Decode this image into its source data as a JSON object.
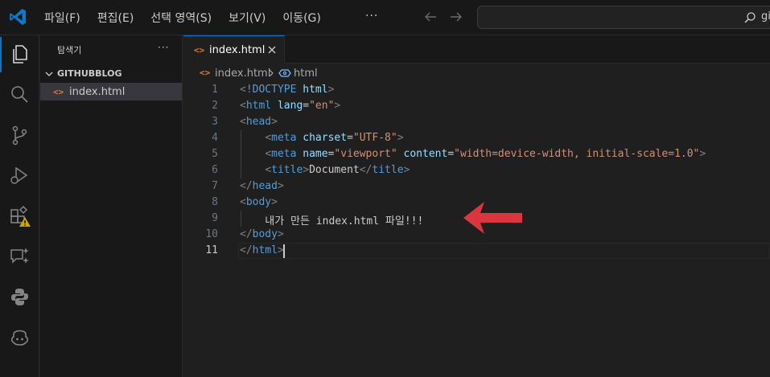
{
  "menu": [
    "파일(F)",
    "편집(E)",
    "선택 영역(S)",
    "보기(V)",
    "이동(G)"
  ],
  "more_label": "···",
  "search": {
    "text": "gi"
  },
  "sidebar": {
    "title": "탐색기",
    "more": "···",
    "folder": "GITHUBBLOG",
    "file_icon": "<>",
    "file": "index.html"
  },
  "tab": {
    "icon": "<>",
    "label": "index.html"
  },
  "breadcrumb": {
    "icon": "<>",
    "file": "index.html",
    "symbol": "html"
  },
  "editor": {
    "line_numbers": [
      "1",
      "2",
      "3",
      "4",
      "5",
      "6",
      "7",
      "8",
      "9",
      "10",
      "11"
    ],
    "lines": [
      [
        [
          "t-br",
          "<"
        ],
        [
          "t-kw",
          "!DOCTYPE "
        ],
        [
          "t-attr",
          "html"
        ],
        [
          "t-br",
          ">"
        ]
      ],
      [
        [
          "t-br",
          "<"
        ],
        [
          "t-tag",
          "html "
        ],
        [
          "t-attr",
          "lang"
        ],
        [
          "t-txt",
          "="
        ],
        [
          "t-str",
          "\"en\""
        ],
        [
          "t-br",
          ">"
        ]
      ],
      [
        [
          "t-br",
          "<"
        ],
        [
          "t-tag",
          "head"
        ],
        [
          "t-br",
          ">"
        ]
      ],
      [
        [
          "t-txt",
          "    "
        ],
        [
          "t-br",
          "<"
        ],
        [
          "t-tag",
          "meta "
        ],
        [
          "t-attr",
          "charset"
        ],
        [
          "t-txt",
          "="
        ],
        [
          "t-str",
          "\"UTF-8\""
        ],
        [
          "t-br",
          ">"
        ]
      ],
      [
        [
          "t-txt",
          "    "
        ],
        [
          "t-br",
          "<"
        ],
        [
          "t-tag",
          "meta "
        ],
        [
          "t-attr",
          "name"
        ],
        [
          "t-txt",
          "="
        ],
        [
          "t-str",
          "\"viewport\" "
        ],
        [
          "t-attr",
          "content"
        ],
        [
          "t-txt",
          "="
        ],
        [
          "t-str",
          "\"width=device-width, initial-scale=1.0\""
        ],
        [
          "t-br",
          ">"
        ]
      ],
      [
        [
          "t-txt",
          "    "
        ],
        [
          "t-br",
          "<"
        ],
        [
          "t-tag",
          "title"
        ],
        [
          "t-br",
          ">"
        ],
        [
          "t-txt",
          "Document"
        ],
        [
          "t-br",
          "</"
        ],
        [
          "t-tag",
          "title"
        ],
        [
          "t-br",
          ">"
        ]
      ],
      [
        [
          "t-br",
          "</"
        ],
        [
          "t-tag",
          "head"
        ],
        [
          "t-br",
          ">"
        ]
      ],
      [
        [
          "t-br",
          "<"
        ],
        [
          "t-tag",
          "body"
        ],
        [
          "t-br",
          ">"
        ]
      ],
      [
        [
          "t-txt",
          "    내가 만든 index.html 파일!!!"
        ]
      ],
      [
        [
          "t-br",
          "</"
        ],
        [
          "t-tag",
          "body"
        ],
        [
          "t-br",
          ">"
        ]
      ],
      [
        [
          "t-br",
          "</"
        ],
        [
          "t-tag",
          "html"
        ],
        [
          "t-br",
          ">"
        ]
      ]
    ],
    "active_line": 11
  },
  "colors": {
    "accent": "#0078d4",
    "annotation_arrow": "#d9363e",
    "warning": "#cca700"
  }
}
